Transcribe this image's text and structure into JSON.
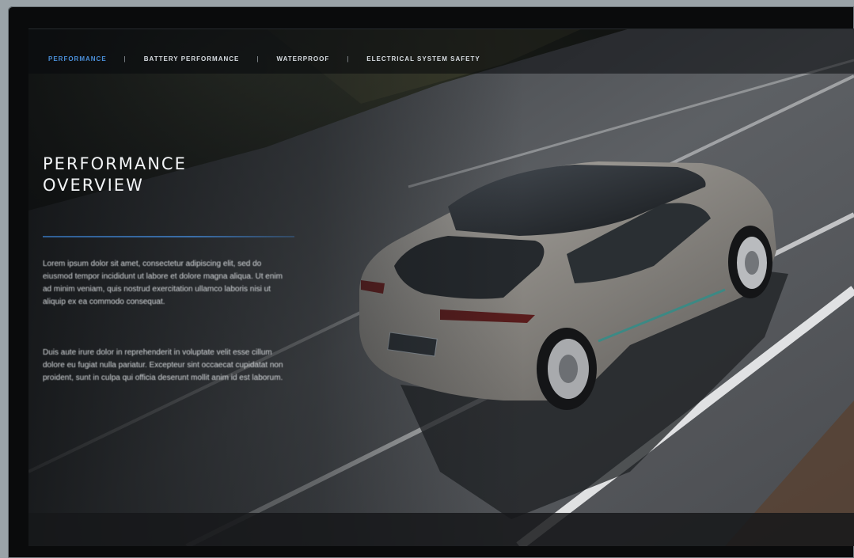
{
  "nav": {
    "tabs": [
      {
        "label": "PERFORMANCE",
        "active": true
      },
      {
        "label": "BATTERY PERFORMANCE",
        "active": false
      },
      {
        "label": "WATERPROOF",
        "active": false
      },
      {
        "label": "ELECTRICAL SYSTEM SAFETY",
        "active": false
      }
    ],
    "separator": "|"
  },
  "hero": {
    "title_line1": "PERFORMANCE",
    "title_line2": "OVERVIEW",
    "paragraph1": "Lorem ipsum dolor sit amet, consectetur adipiscing elit, sed do eiusmod tempor incididunt ut labore et dolore magna aliqua. Ut enim ad minim veniam, quis nostrud exercitation ullamco laboris nisi ut aliquip ex ea commodo consequat.",
    "paragraph2": "Duis aute irure dolor in reprehenderit in voluptate velit esse cillum dolore eu fugiat nulla pariatur. Excepteur sint occaecat cupidatat non proident, sunt in culpa qui officia deserunt mollit anim id est laborum."
  },
  "colors": {
    "accent": "#4a8fd9",
    "rule": "#3b6ea8",
    "car_body": "#8d8a86",
    "road": "#55585c"
  }
}
